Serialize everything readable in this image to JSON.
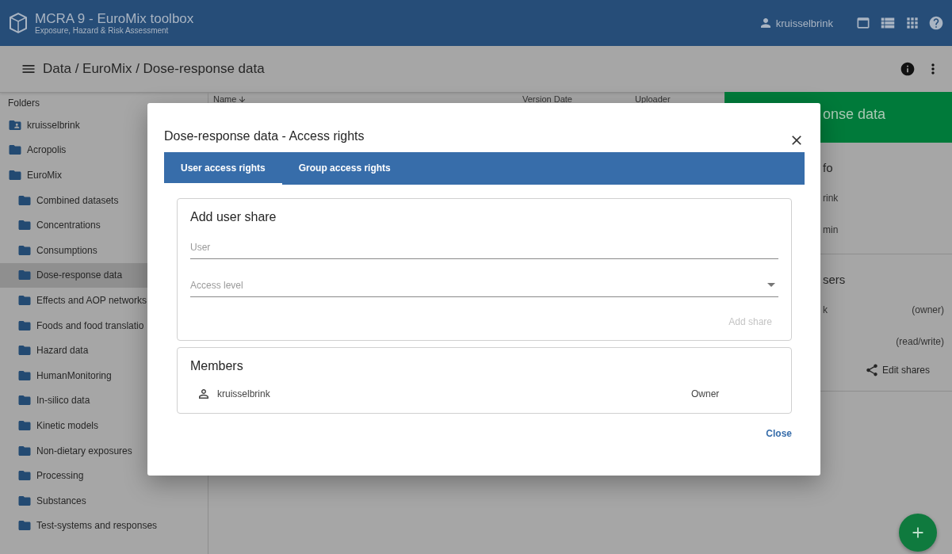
{
  "app": {
    "title": "MCRA 9 - EuroMix toolbox",
    "subtitle": "Exposure, Hazard & Risk Assessment",
    "user": "kruisselbrink"
  },
  "breadcrumb": "Data / EuroMix / Dose-response data",
  "sidebar": {
    "heading": "Folders",
    "items": [
      {
        "label": "kruisselbrink",
        "kind": "user",
        "selected": false
      },
      {
        "label": "Acropolis",
        "kind": "folder",
        "selected": false
      },
      {
        "label": "EuroMix",
        "kind": "folder",
        "selected": false,
        "children": [
          {
            "label": "Combined datasets",
            "kind": "folder",
            "selected": false
          },
          {
            "label": "Concentrations",
            "kind": "folder",
            "selected": false
          },
          {
            "label": "Consumptions",
            "kind": "folder",
            "selected": false
          },
          {
            "label": "Dose-response data",
            "kind": "folder",
            "selected": true
          },
          {
            "label": "Effects and AOP networks",
            "kind": "folder",
            "selected": false
          },
          {
            "label": "Foods and food translatio",
            "kind": "folder",
            "selected": false
          },
          {
            "label": "Hazard data",
            "kind": "folder",
            "selected": false
          },
          {
            "label": "HumanMonitoring",
            "kind": "folder",
            "selected": false
          },
          {
            "label": "In-silico data",
            "kind": "folder",
            "selected": false
          },
          {
            "label": "Kinetic models",
            "kind": "folder",
            "selected": false
          },
          {
            "label": "Non-dietary exposures",
            "kind": "folder",
            "selected": false
          },
          {
            "label": "Processing",
            "kind": "folder",
            "selected": false
          },
          {
            "label": "Substances",
            "kind": "folder",
            "selected": false
          },
          {
            "label": "Test-systems and responses",
            "kind": "folder",
            "selected": false
          }
        ]
      }
    ]
  },
  "table": {
    "columns": [
      "Name",
      "Version Date",
      "Uploader"
    ]
  },
  "right_panel": {
    "header": "onse data",
    "info": {
      "heading": "fo",
      "rows": [
        "rink",
        "min"
      ]
    },
    "users": {
      "heading": "sers",
      "rows": [
        {
          "name": "k",
          "role": "(owner)"
        },
        {
          "role": "(read/write)"
        }
      ]
    },
    "edit_shares": "Edit shares"
  },
  "dialog": {
    "title": "Dose-response data - Access rights",
    "tabs": [
      {
        "label": "User access rights",
        "selected": true
      },
      {
        "label": "Group access rights",
        "selected": false
      }
    ],
    "add_share": {
      "heading": "Add user share",
      "user_field": {
        "placeholder": "User"
      },
      "access_field": {
        "placeholder": "Access level"
      },
      "button": "Add share",
      "button_disabled": true
    },
    "members": {
      "heading": "Members",
      "rows": [
        {
          "name": "kruisselbrink",
          "role": "Owner"
        }
      ]
    },
    "close": "Close"
  }
}
